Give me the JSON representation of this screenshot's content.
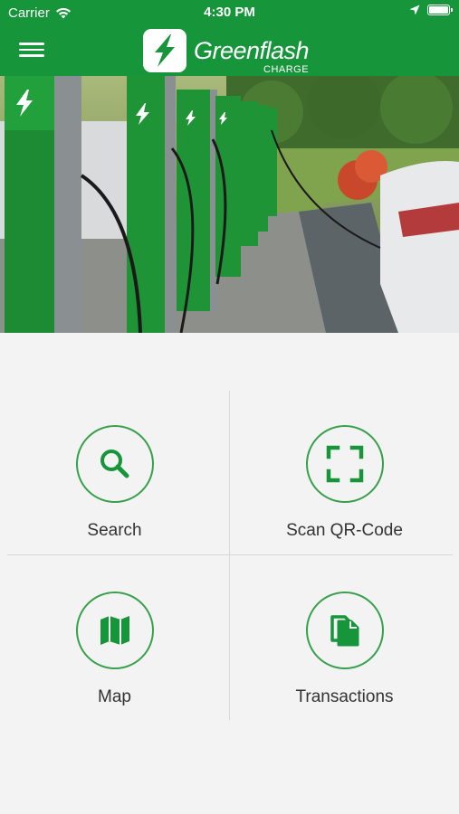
{
  "status": {
    "carrier": "Carrier",
    "time": "4:30 PM"
  },
  "header": {
    "brand": "Greenflash",
    "sub": "CHARGE",
    "menu_icon": "hamburger-icon"
  },
  "hero": {
    "description": "EV charging stations photo"
  },
  "menu": {
    "items": [
      {
        "label": "Search",
        "icon": "search-icon"
      },
      {
        "label": "Scan QR-Code",
        "icon": "qr-scan-icon"
      },
      {
        "label": "Map",
        "icon": "map-icon"
      },
      {
        "label": "Transactions",
        "icon": "documents-icon"
      }
    ]
  },
  "colors": {
    "primary": "#16953a",
    "accent": "#37a04b",
    "background": "#f3f3f3",
    "text": "#333333"
  }
}
